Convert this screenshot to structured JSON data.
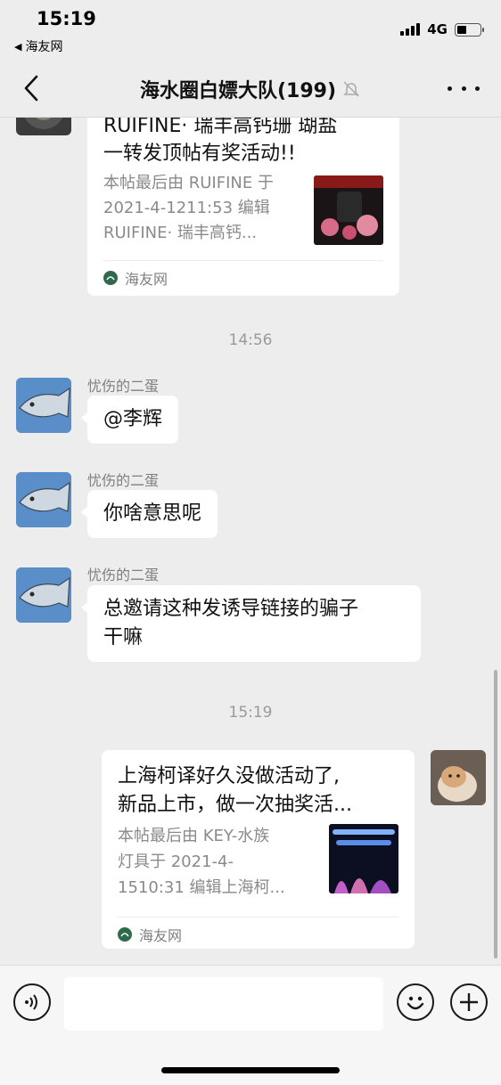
{
  "status_bar": {
    "time": "15:19",
    "back_app": "海友网",
    "network": "4G"
  },
  "nav": {
    "title": "海水圈白嫖大队(199)"
  },
  "messages": {
    "card1": {
      "title": "RUIFINE· 瑞丰高钙珊 瑚盐一转发顶帖有奖活动!!",
      "title_line1": "RUIFINE· 瑞丰高钙珊 瑚盐",
      "title_line2": "一转发顶帖有奖活动!!",
      "desc_line1": "本帖最后由 RUIFINE 于",
      "desc_line2": "2021-4-1211:53 编辑",
      "desc_line3": "RUIFINE· 瑞丰高钙...",
      "source": "海友网"
    },
    "time1": "14:56",
    "msg1": {
      "sender": "忧伤的二蛋",
      "text": "@李辉"
    },
    "msg2": {
      "sender": "忧伤的二蛋",
      "text": "你啥意思呢"
    },
    "msg3": {
      "sender": "忧伤的二蛋",
      "line1": "总邀请这种发诱导链接的骗子",
      "line2": "干嘛"
    },
    "time2": "15:19",
    "card2": {
      "title_line1": "上海柯译好久没做活动了,",
      "title_line2": "新品上市，做一次抽奖活...",
      "desc_line1": "本帖最后由 KEY-水族",
      "desc_line2": "灯具于 2021-4-",
      "desc_line3": "1510:31 编辑上海柯...",
      "source": "海友网"
    }
  },
  "input": {
    "placeholder": ""
  },
  "colors": {
    "background": "#ededed",
    "bubble": "#ffffff",
    "meta_text": "#8a8a8a"
  }
}
